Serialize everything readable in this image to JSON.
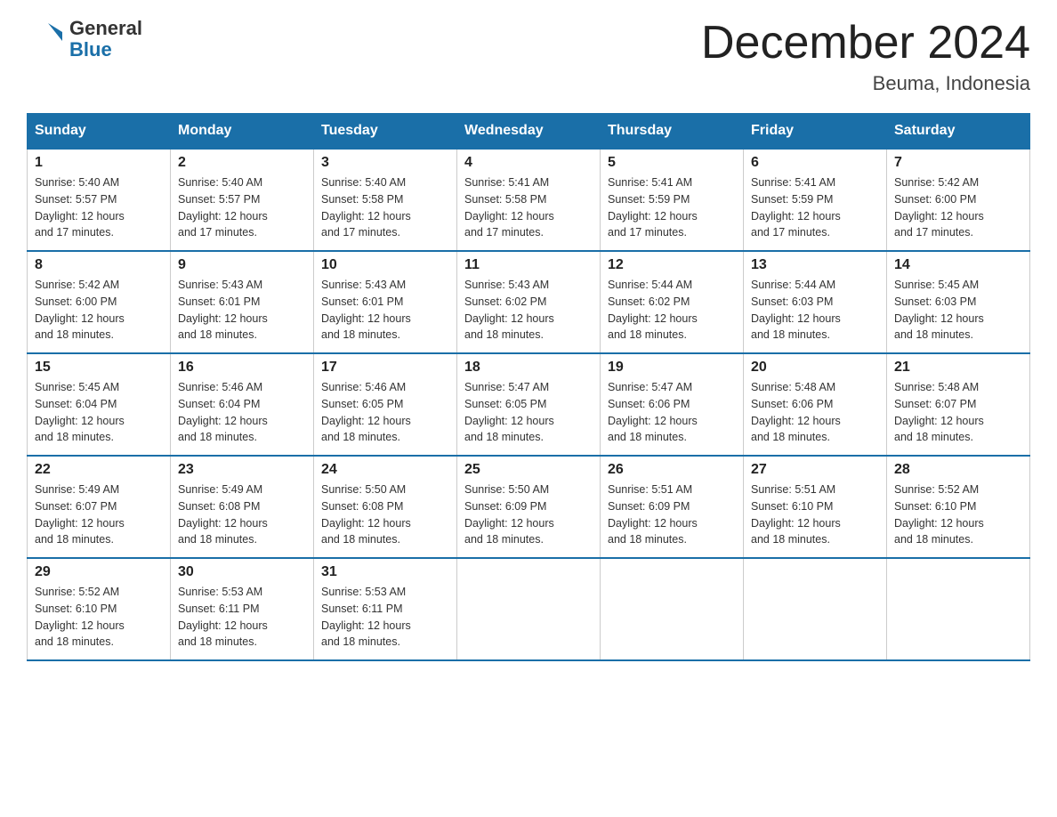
{
  "header": {
    "logo_general": "General",
    "logo_blue": "Blue",
    "month_title": "December 2024",
    "location": "Beuma, Indonesia"
  },
  "calendar": {
    "days_of_week": [
      "Sunday",
      "Monday",
      "Tuesday",
      "Wednesday",
      "Thursday",
      "Friday",
      "Saturday"
    ],
    "weeks": [
      [
        {
          "day": "1",
          "sunrise": "5:40 AM",
          "sunset": "5:57 PM",
          "daylight": "12 hours and 17 minutes."
        },
        {
          "day": "2",
          "sunrise": "5:40 AM",
          "sunset": "5:57 PM",
          "daylight": "12 hours and 17 minutes."
        },
        {
          "day": "3",
          "sunrise": "5:40 AM",
          "sunset": "5:58 PM",
          "daylight": "12 hours and 17 minutes."
        },
        {
          "day": "4",
          "sunrise": "5:41 AM",
          "sunset": "5:58 PM",
          "daylight": "12 hours and 17 minutes."
        },
        {
          "day": "5",
          "sunrise": "5:41 AM",
          "sunset": "5:59 PM",
          "daylight": "12 hours and 17 minutes."
        },
        {
          "day": "6",
          "sunrise": "5:41 AM",
          "sunset": "5:59 PM",
          "daylight": "12 hours and 17 minutes."
        },
        {
          "day": "7",
          "sunrise": "5:42 AM",
          "sunset": "6:00 PM",
          "daylight": "12 hours and 17 minutes."
        }
      ],
      [
        {
          "day": "8",
          "sunrise": "5:42 AM",
          "sunset": "6:00 PM",
          "daylight": "12 hours and 18 minutes."
        },
        {
          "day": "9",
          "sunrise": "5:43 AM",
          "sunset": "6:01 PM",
          "daylight": "12 hours and 18 minutes."
        },
        {
          "day": "10",
          "sunrise": "5:43 AM",
          "sunset": "6:01 PM",
          "daylight": "12 hours and 18 minutes."
        },
        {
          "day": "11",
          "sunrise": "5:43 AM",
          "sunset": "6:02 PM",
          "daylight": "12 hours and 18 minutes."
        },
        {
          "day": "12",
          "sunrise": "5:44 AM",
          "sunset": "6:02 PM",
          "daylight": "12 hours and 18 minutes."
        },
        {
          "day": "13",
          "sunrise": "5:44 AM",
          "sunset": "6:03 PM",
          "daylight": "12 hours and 18 minutes."
        },
        {
          "day": "14",
          "sunrise": "5:45 AM",
          "sunset": "6:03 PM",
          "daylight": "12 hours and 18 minutes."
        }
      ],
      [
        {
          "day": "15",
          "sunrise": "5:45 AM",
          "sunset": "6:04 PM",
          "daylight": "12 hours and 18 minutes."
        },
        {
          "day": "16",
          "sunrise": "5:46 AM",
          "sunset": "6:04 PM",
          "daylight": "12 hours and 18 minutes."
        },
        {
          "day": "17",
          "sunrise": "5:46 AM",
          "sunset": "6:05 PM",
          "daylight": "12 hours and 18 minutes."
        },
        {
          "day": "18",
          "sunrise": "5:47 AM",
          "sunset": "6:05 PM",
          "daylight": "12 hours and 18 minutes."
        },
        {
          "day": "19",
          "sunrise": "5:47 AM",
          "sunset": "6:06 PM",
          "daylight": "12 hours and 18 minutes."
        },
        {
          "day": "20",
          "sunrise": "5:48 AM",
          "sunset": "6:06 PM",
          "daylight": "12 hours and 18 minutes."
        },
        {
          "day": "21",
          "sunrise": "5:48 AM",
          "sunset": "6:07 PM",
          "daylight": "12 hours and 18 minutes."
        }
      ],
      [
        {
          "day": "22",
          "sunrise": "5:49 AM",
          "sunset": "6:07 PM",
          "daylight": "12 hours and 18 minutes."
        },
        {
          "day": "23",
          "sunrise": "5:49 AM",
          "sunset": "6:08 PM",
          "daylight": "12 hours and 18 minutes."
        },
        {
          "day": "24",
          "sunrise": "5:50 AM",
          "sunset": "6:08 PM",
          "daylight": "12 hours and 18 minutes."
        },
        {
          "day": "25",
          "sunrise": "5:50 AM",
          "sunset": "6:09 PM",
          "daylight": "12 hours and 18 minutes."
        },
        {
          "day": "26",
          "sunrise": "5:51 AM",
          "sunset": "6:09 PM",
          "daylight": "12 hours and 18 minutes."
        },
        {
          "day": "27",
          "sunrise": "5:51 AM",
          "sunset": "6:10 PM",
          "daylight": "12 hours and 18 minutes."
        },
        {
          "day": "28",
          "sunrise": "5:52 AM",
          "sunset": "6:10 PM",
          "daylight": "12 hours and 18 minutes."
        }
      ],
      [
        {
          "day": "29",
          "sunrise": "5:52 AM",
          "sunset": "6:10 PM",
          "daylight": "12 hours and 18 minutes."
        },
        {
          "day": "30",
          "sunrise": "5:53 AM",
          "sunset": "6:11 PM",
          "daylight": "12 hours and 18 minutes."
        },
        {
          "day": "31",
          "sunrise": "5:53 AM",
          "sunset": "6:11 PM",
          "daylight": "12 hours and 18 minutes."
        },
        null,
        null,
        null,
        null
      ]
    ]
  }
}
